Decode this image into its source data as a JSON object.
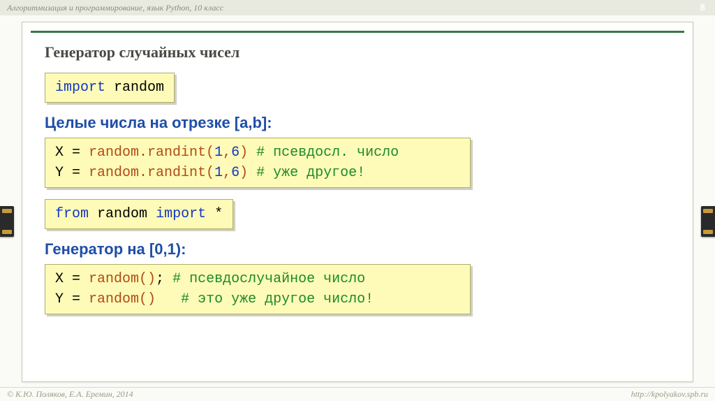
{
  "meta": {
    "course": "Алгоритмизация и программирование, язык Python, 10 класс",
    "page": "8",
    "copyright": "© К.Ю. Поляков, Е.А. Еремин, 2014",
    "url": "http://kpolyakov.spb.ru"
  },
  "title": "Генератор случайных чисел",
  "code1": {
    "kw": "import",
    "mod": "random"
  },
  "sub1": "Целые числа на отрезке [a,b]:",
  "code2": {
    "l1": {
      "lhs": "X =",
      "call": "random.randint(",
      "a": "1",
      "c1": ",",
      "b": "6",
      "rp": ")",
      "cmt": "# псевдосл. число"
    },
    "l2": {
      "lhs": "Y =",
      "call": "random.randint(",
      "a": "1",
      "c1": ",",
      "b": "6",
      "rp": ")",
      "cmt": "# уже другое!"
    }
  },
  "code3": {
    "kw1": "from",
    "mod": "random",
    "kw2": "import",
    "star": "*"
  },
  "sub2": "Генератор на [0,1):",
  "code4": {
    "l1": {
      "lhs": "X =",
      "call": "random()",
      "sep": ";",
      "cmt": "# псевдослучайное число"
    },
    "l2": {
      "lhs": "Y =",
      "call": "random()",
      "sep": " ",
      "cmt": "# это уже другое число!"
    }
  }
}
